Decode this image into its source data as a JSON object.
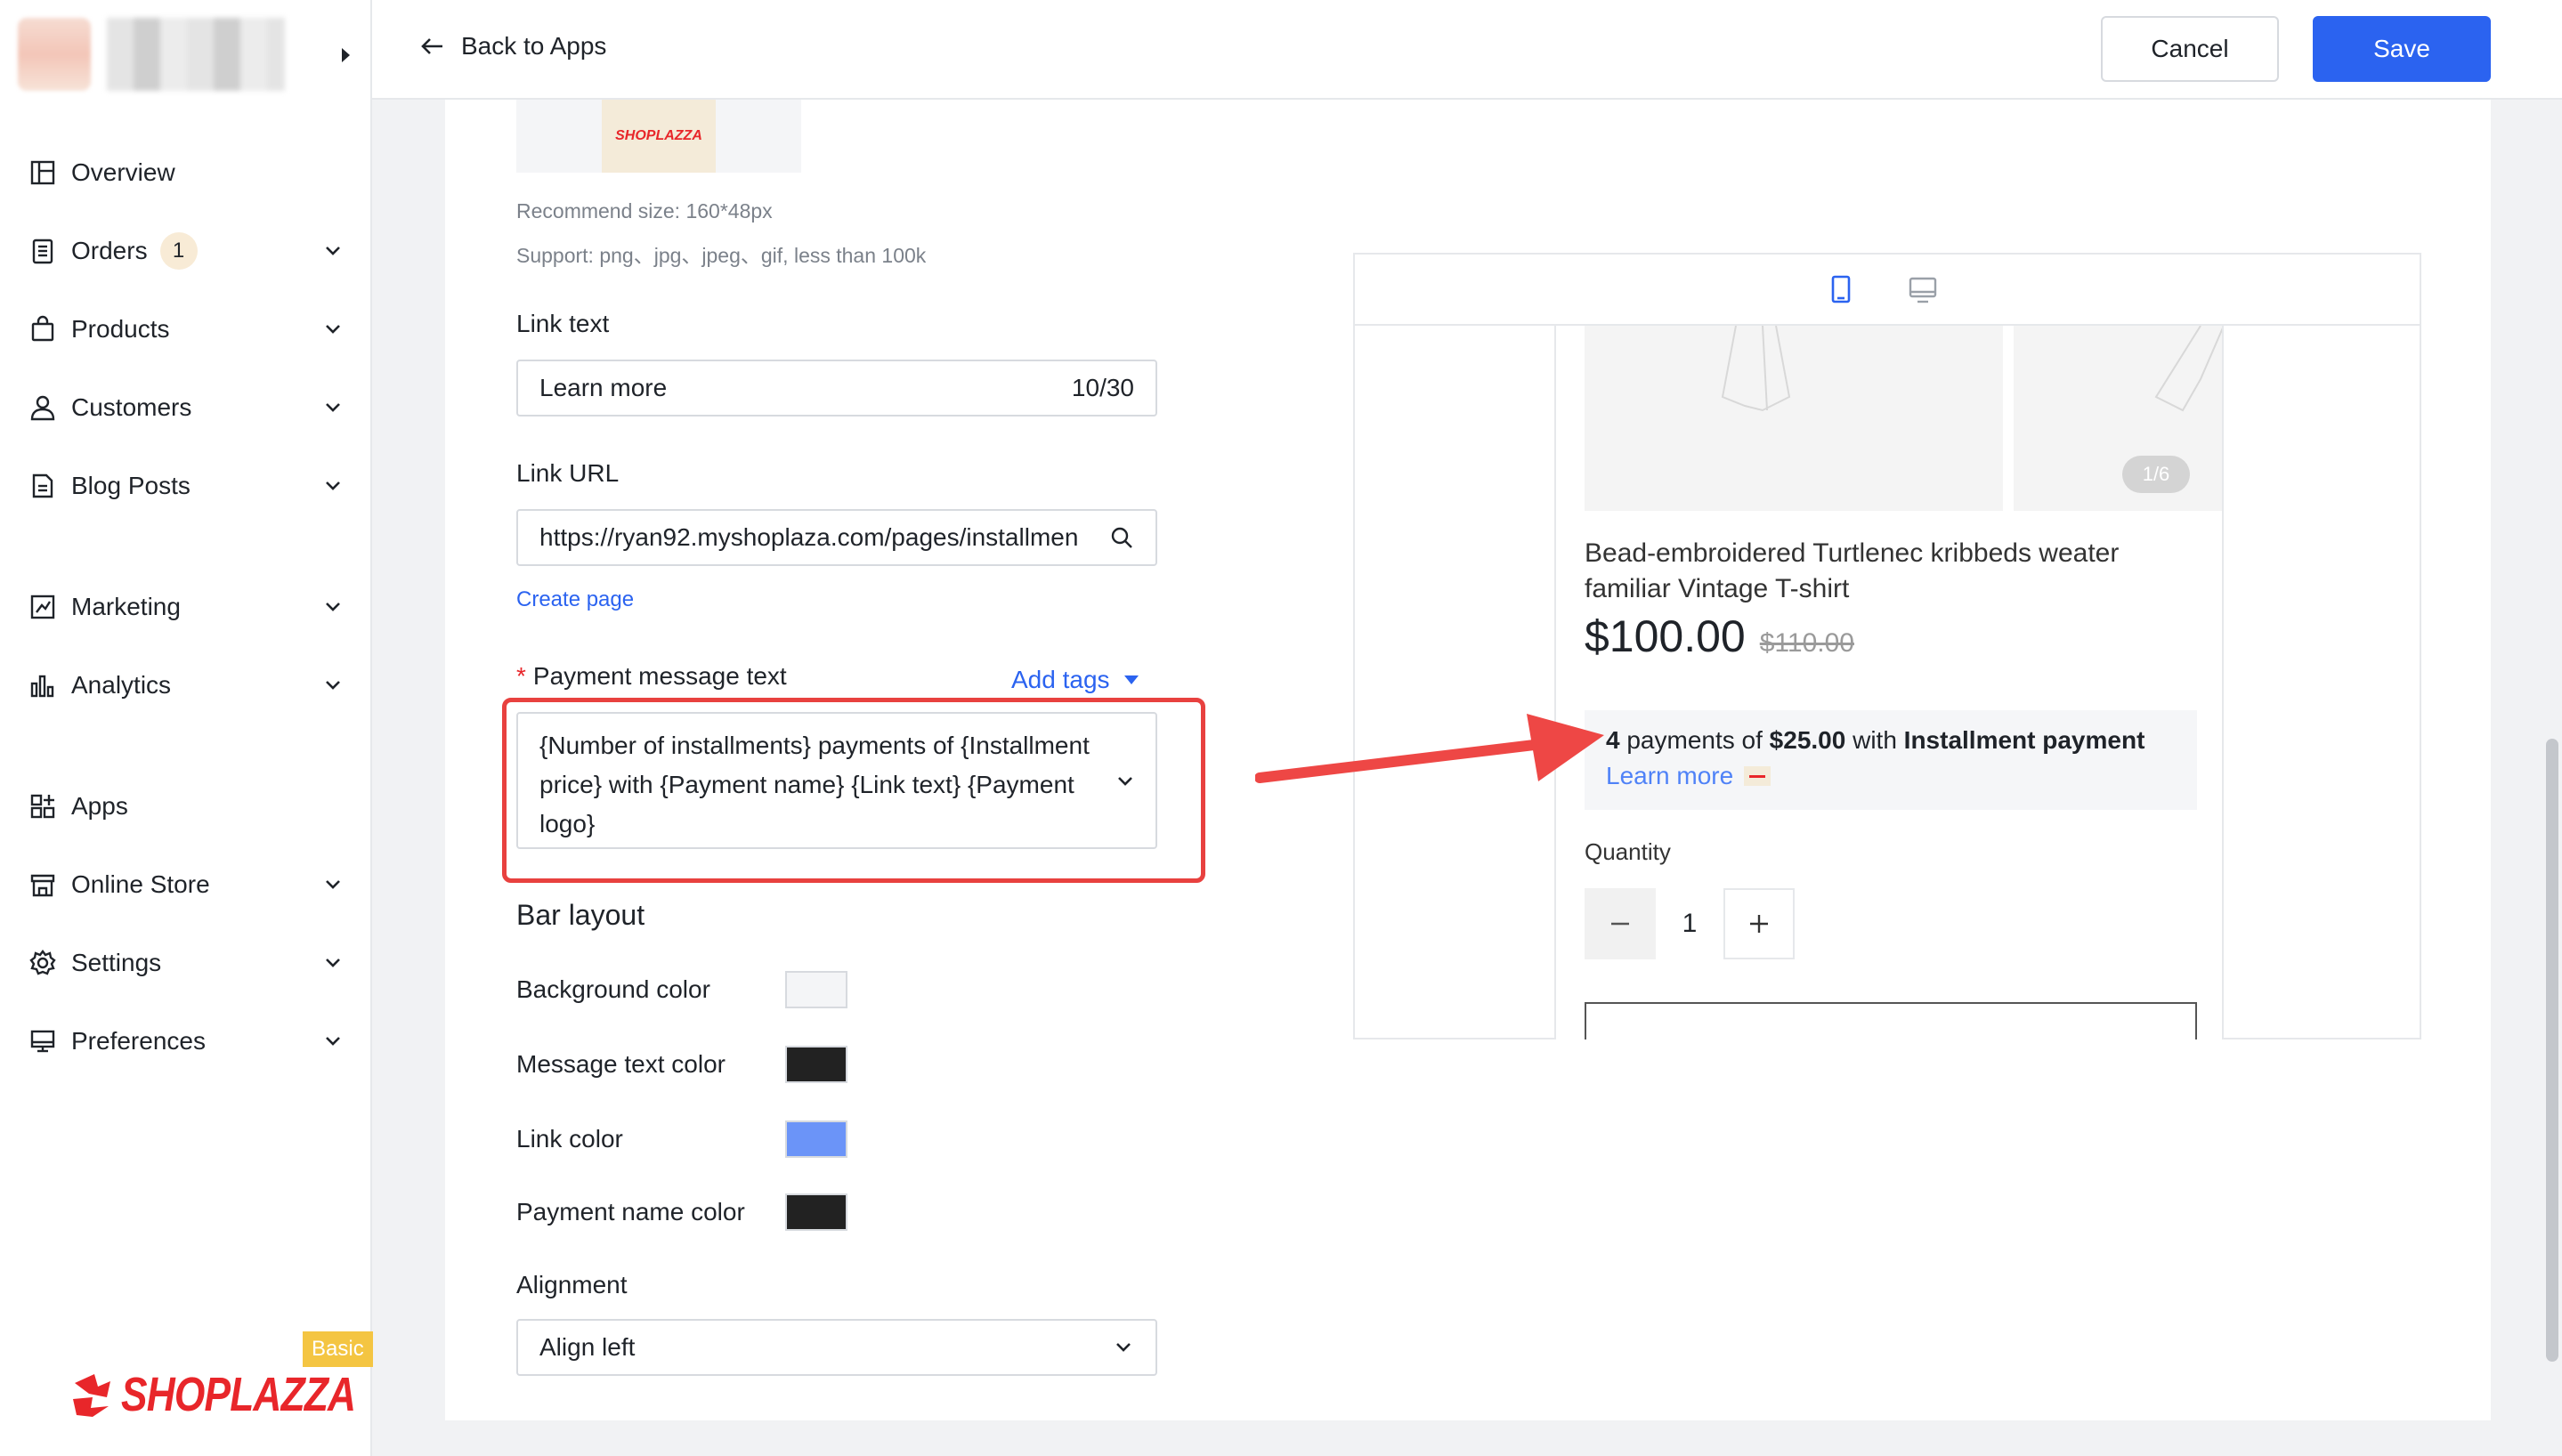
{
  "nav": {
    "items": [
      {
        "label": "Overview"
      },
      {
        "label": "Orders",
        "badge": "1"
      },
      {
        "label": "Products"
      },
      {
        "label": "Customers"
      },
      {
        "label": "Blog Posts"
      },
      {
        "label": "Marketing"
      },
      {
        "label": "Analytics"
      },
      {
        "label": "Apps"
      },
      {
        "label": "Online Store"
      },
      {
        "label": "Settings"
      },
      {
        "label": "Preferences"
      }
    ]
  },
  "brand": {
    "plan": "Basic",
    "name": "SHOPLAZZA"
  },
  "topbar": {
    "back_label": "Back to Apps",
    "cancel_label": "Cancel",
    "save_label": "Save"
  },
  "form": {
    "logo_preview_text": "SHOPLAZZA",
    "recommend_size": "Recommend size: 160*48px",
    "support": "Support: png、jpg、jpeg、gif, less than 100k",
    "link_text": {
      "label": "Link text",
      "value": "Learn more",
      "counter": "10/30"
    },
    "link_url": {
      "label": "Link URL",
      "value": "https://ryan92.myshoplaza.com/pages/installmen"
    },
    "create_page": "Create page",
    "payment_message": {
      "label": "Payment message text",
      "add_tags": "Add tags",
      "value": "{Number of installments} payments of {Installment price} with {Payment name} {Link text} {Payment logo}"
    },
    "bar_layout": {
      "title": "Bar layout",
      "background_color": {
        "label": "Background color",
        "color": "#f4f5f7"
      },
      "message_text_color": {
        "label": "Message text color",
        "color": "#222222"
      },
      "link_color": {
        "label": "Link color",
        "color": "#6b94f8"
      },
      "payment_name_color": {
        "label": "Payment name color",
        "color": "#222222"
      }
    },
    "alignment": {
      "label": "Alignment",
      "value": "Align left"
    }
  },
  "preview": {
    "image_counter": "1/6",
    "product_title": "Bead-embroidered Turtlenec kribbeds weater familiar Vintage T-shirt",
    "price": "$100.00",
    "compare_price": "$110.00",
    "message": {
      "count": "4",
      "mid1": " payments of ",
      "amount": "$25.00",
      "mid2": " with ",
      "payment_name": "Installment payment",
      "link": "Learn more"
    },
    "quantity_label": "Quantity",
    "quantity_value": "1"
  }
}
